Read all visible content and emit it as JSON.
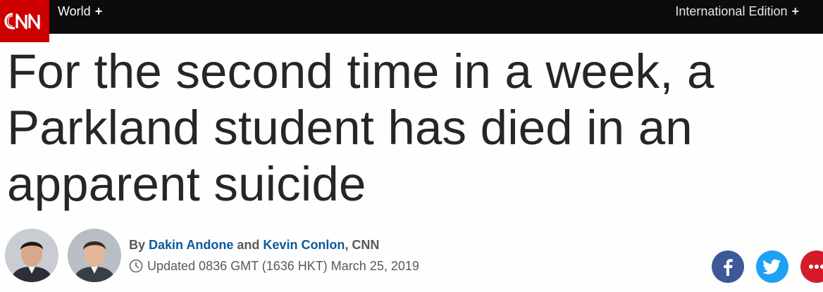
{
  "header": {
    "brand": "CNN",
    "section_label": "World",
    "section_plus": "+",
    "edition_label": "International Edition",
    "edition_plus": "+"
  },
  "article": {
    "headline": "For the second time in a week, a Parkland student has died in an apparent suicide",
    "byline": {
      "prefix": "By",
      "author1": "Dakin Andone",
      "conjunction": "and",
      "author2": "Kevin Conlon",
      "source": ", CNN"
    },
    "updated": "Updated 0836 GMT (1636 HKT) March 25, 2019"
  },
  "share": {
    "facebook_icon": "facebook-icon",
    "twitter_icon": "twitter-icon",
    "more_icon": "more-icon"
  },
  "colors": {
    "brand_red": "#cc0000",
    "topbar": "#0c0c0c",
    "author_link": "#0c5a9b",
    "facebook": "#3b5998",
    "twitter": "#1da1f2",
    "more": "#d41b2a"
  }
}
